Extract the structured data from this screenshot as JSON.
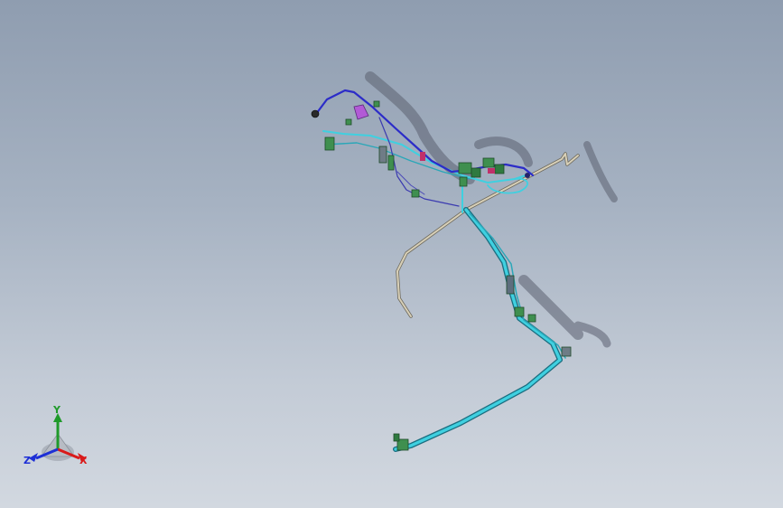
{
  "viewport": {
    "background_top": "#8f9db0",
    "background_bottom": "#d2d8e0"
  },
  "model": {
    "colors": {
      "rigid_pipe": "#d8d0b8",
      "cyan_hose": "#3fd0e0",
      "blue_line": "#2c2cc8",
      "fitting": "#3f8f4f",
      "magenta_part": "#b25ad6",
      "shadow": "#5b6070"
    }
  },
  "triad": {
    "y_label": "Y",
    "z_label": "Z",
    "x_label": "X",
    "colors": {
      "y": "#1f9a2a",
      "z": "#1d2fd6",
      "x": "#d91a1a"
    },
    "icon": "coordinate-triad-icon"
  }
}
